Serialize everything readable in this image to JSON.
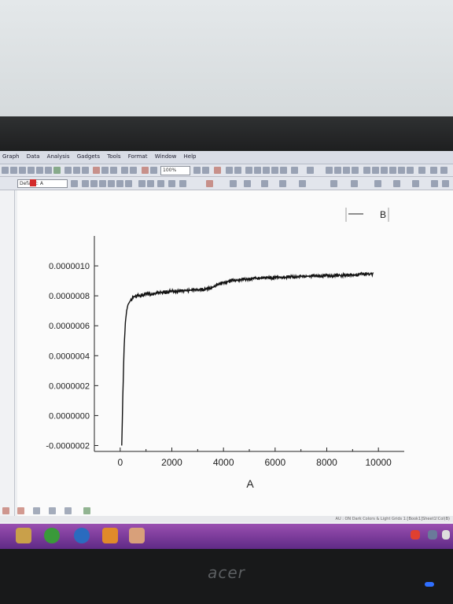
{
  "menubar": {
    "items": [
      "Graph",
      "Data",
      "Analysis",
      "Gadgets",
      "Tools",
      "Format",
      "Window",
      "Help"
    ]
  },
  "toolbar": {
    "zoom_value": "100%",
    "font_value": "Default: A"
  },
  "monitor": {
    "brand": "acer"
  },
  "statusbar": {
    "text": "AU : ON  Dark Colors & Light Grids  1:[Book1]Sheet1!Col(B)"
  },
  "chart_data": {
    "type": "line",
    "title": "",
    "xlabel": "A",
    "ylabel": "",
    "xlim": [
      -1000,
      11000
    ],
    "ylim": [
      -2.5e-07,
      1.2e-06
    ],
    "xticks": [
      0,
      2000,
      4000,
      6000,
      8000,
      10000
    ],
    "xtick_labels": [
      "0",
      "2000",
      "4000",
      "6000",
      "8000",
      "10000"
    ],
    "yticks": [
      -2e-07,
      0.0,
      2e-07,
      4e-07,
      6e-07,
      8e-07,
      1e-06
    ],
    "ytick_labels": [
      "-0.0000002",
      "0.0000000",
      "0.0000002",
      "0.0000004",
      "0.0000006",
      "0.0000008",
      "0.0000010"
    ],
    "grid": false,
    "legend_position": "top-right",
    "series": [
      {
        "name": "B",
        "color": "#111111",
        "noise": 1.2e-08,
        "x": [
          60,
          100,
          150,
          200,
          250,
          300,
          400,
          500,
          700,
          1000,
          1500,
          2000,
          2500,
          3000,
          3300,
          3600,
          4000,
          4500,
          5000,
          5500,
          6000,
          6500,
          7000,
          7500,
          8000,
          8500,
          9000,
          9500,
          9800
        ],
        "y": [
          -2e-07,
          1.2e-07,
          4.5e-07,
          6.2e-07,
          7e-07,
          7.4e-07,
          7.7e-07,
          7.9e-07,
          8e-07,
          8.1e-07,
          8.2e-07,
          8.3e-07,
          8.35e-07,
          8.4e-07,
          8.45e-07,
          8.6e-07,
          8.9e-07,
          9.05e-07,
          9.15e-07,
          9.2e-07,
          9.22e-07,
          9.25e-07,
          9.3e-07,
          9.32e-07,
          9.35e-07,
          9.37e-07,
          9.4e-07,
          9.45e-07,
          9.48e-07
        ]
      }
    ]
  }
}
